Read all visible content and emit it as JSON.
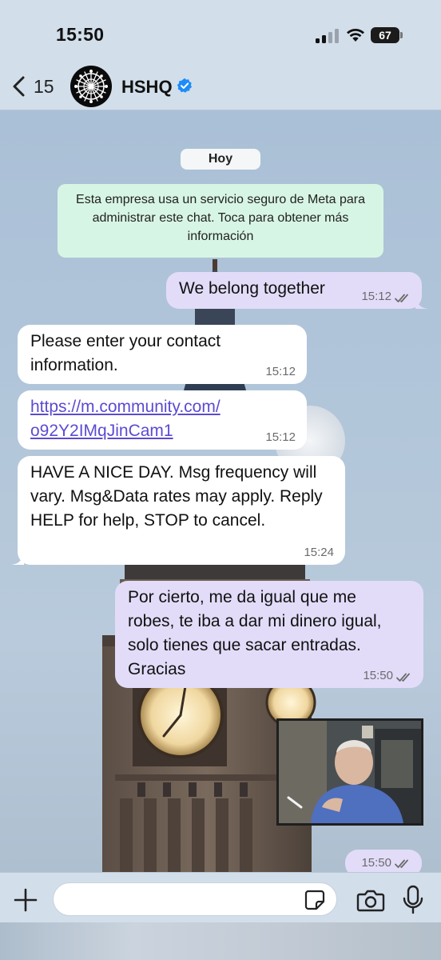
{
  "status_bar": {
    "time": "15:50",
    "battery": "67",
    "icons": [
      "signal-icon",
      "wifi-icon",
      "battery-icon"
    ]
  },
  "header": {
    "back_count": "15",
    "contact_name": "HSHQ",
    "verified": true,
    "icons": [
      "back-chevron-icon",
      "verified-badge-icon"
    ]
  },
  "chat": {
    "date_label": "Hoy",
    "system_notice": "Esta empresa usa un servicio seguro de Meta para administrar este chat. Toca para obtener más información",
    "messages": [
      {
        "direction": "out",
        "text": "We belong together",
        "time": "15:12",
        "status": "read"
      },
      {
        "direction": "in",
        "text": "Please enter your contact information.",
        "time": "15:12"
      },
      {
        "direction": "in",
        "text": "https://m.community.com/o92Y2IMqJinCam1",
        "link_line1": "https://m.community.com/",
        "link_line2": "o92Y2IMqJinCam1",
        "time": "15:12"
      },
      {
        "direction": "in",
        "text": "HAVE A NICE DAY. Msg frequency will vary. Msg&Data rates may apply. Reply HELP for help, STOP to cancel.",
        "time": "15:24"
      },
      {
        "direction": "out",
        "text": "Por cierto, me da igual que me robes, te iba a dar mi dinero igual, solo tienes que sacar entradas. Gracias",
        "time": "15:50",
        "status": "read"
      },
      {
        "direction": "out",
        "type": "image",
        "time": "15:50",
        "status": "read"
      }
    ]
  },
  "composer": {
    "placeholder": "",
    "icons": [
      "plus-icon",
      "sticker-icon",
      "camera-icon",
      "microphone-icon"
    ]
  },
  "colors": {
    "incoming_bubble": "#ffffff",
    "outgoing_bubble": "#e2dcf9",
    "system_notice": "#d7f5e4",
    "verified_blue": "#1d8cf8",
    "link": "#5b4bd1"
  }
}
